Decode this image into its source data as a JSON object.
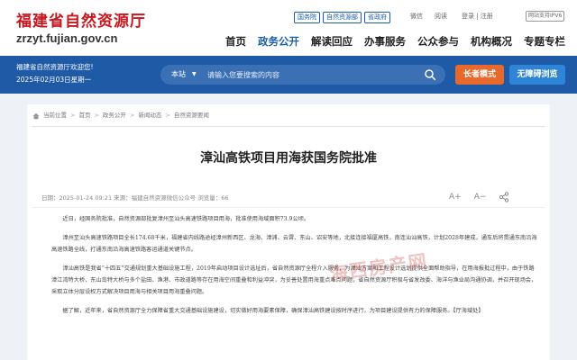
{
  "header": {
    "logo_cn": "福建省自然资源厅",
    "logo_en": "zrzyt.fujian.gov.cn",
    "top_links": [
      "国务院",
      "自然资源部",
      "省政府"
    ],
    "util_wechat": "微信",
    "util_read": "阅读",
    "util_login": "登录 | 注册",
    "util_ipv6": "网站支持IPV6"
  },
  "nav": [
    "首页",
    "政务公开",
    "解读回应",
    "办事服务",
    "公众参与",
    "机构概况",
    "专题专栏"
  ],
  "banner": {
    "welcome": "福建省自然资源厅欢迎您!",
    "date": "2025年02月03日星期一",
    "search_scope": "本站",
    "search_placeholder": "请输入您要搜索的内容",
    "elder_mode": "长者模式",
    "accessible": "无障碍浏览"
  },
  "breadcrumb": [
    "当前位置",
    "首页",
    "政务公开",
    "新闻动态",
    "自然资源要闻"
  ],
  "article": {
    "title": "漳汕高铁项目用海获国务院批准",
    "meta": "日期：2025-01-24 09:21      来源：福建自然资源微信公众号      浏览量：66",
    "font_up": "A+",
    "font_down": "A−",
    "paragraphs": [
      "近日，经国务院批准，自然资源部批复漳州至汕头高速铁路项目用海，批准使用海域面积73.9公顷。",
      "漳州至汕头高速铁路项目全长174.68千米，福建省内线路途经漳州新西区、龙海、漳浦、云霄、东山、诏安等地，北接连接福厦高铁，南连汕汕高铁，计划2028年建成，通车后将贯通东南沿海高速铁路全线，打通东南沿海高速铁路客运通道关键节点。",
      "漳汕高铁是我省“十四五”交通规划重大基础设施工程，2019年启动项目设计选址后，省自然资源厅全程介入服务，为漳汕方案和工程设计选划提供全面帮助指导，在用海报批过程中，由于铁路漳江湾特大桥、东山岛特大桥与多个盐田、渔港、市政道路等存在用海空间重叠和利益冲突，为妥善处置用海重点难点问题，省自然资源厅积极与省发改委、海洋与渔业局沟通协调，并召开现场会，采取立体分层设权方式解决项目用海与相关项目用海重叠问题。",
      "据了解，近年来，省自然资源厅全力保障省重大交通基础设施建设，切实做好用海要素保障，确保漳汕高铁建设按时序进行，为项目建设提供有力的保障服务。【厅海域处】"
    ],
    "watermark": "海西房产网"
  },
  "colors": {
    "brand_red": "#c8161d",
    "banner_blue": "#1f5aa6",
    "elder_orange": "#e8692c",
    "access_blue": "#2e84d6"
  }
}
